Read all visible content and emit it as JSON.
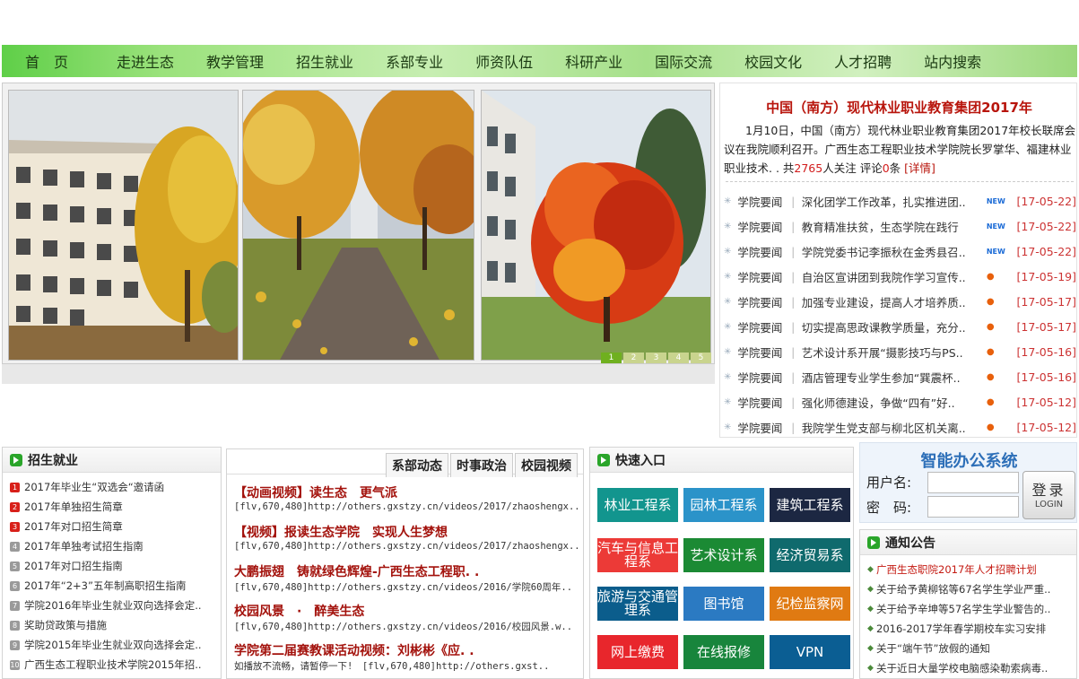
{
  "nav": {
    "items": [
      "首　页",
      "走进生态",
      "教学管理",
      "招生就业",
      "系部专业",
      "师资队伍",
      "科研产业",
      "国际交流",
      "校园文化",
      "人才招聘",
      "站内搜索"
    ]
  },
  "slider": {
    "pages": [
      "1",
      "2",
      "3",
      "4",
      "5"
    ],
    "active_page": "1"
  },
  "headline": {
    "title": "中国（南方）现代林业职业教育集团2017年",
    "body_text": "1月10日，中国（南方）现代林业职业教育集团2017年校长联席会议在我院顺利召开。广西生态工程职业技术学院院长罗掌华、福建林业职业技术. . 共",
    "views_count": "2765",
    "views_suffix": "人关注 评论",
    "comments_count": "0",
    "comments_suffix": "条",
    "more_label": "[详情]"
  },
  "news": [
    {
      "category": "学院要闻",
      "title": "深化团学工作改革，扎实推进团..",
      "badge": "NEW",
      "date": "[17-05-22]"
    },
    {
      "category": "学院要闻",
      "title": "教育精准扶贫，生态学院在践行",
      "badge": "NEW",
      "date": "[17-05-22]"
    },
    {
      "category": "学院要闻",
      "title": "学院党委书记李振秋在金秀县召..",
      "badge": "NEW",
      "date": "[17-05-22]"
    },
    {
      "category": "学院要闻",
      "title": "自治区宣讲团到我院作学习宣传..",
      "badge": "hot",
      "date": "[17-05-19]"
    },
    {
      "category": "学院要闻",
      "title": "加强专业建设，提高人才培养质..",
      "badge": "hot",
      "date": "[17-05-17]"
    },
    {
      "category": "学院要闻",
      "title": "切实提高思政课教学质量，充分..",
      "badge": "hot",
      "date": "[17-05-17]"
    },
    {
      "category": "学院要闻",
      "title": "艺术设计系开展“摄影技巧与PS..",
      "badge": "hot",
      "date": "[17-05-16]"
    },
    {
      "category": "学院要闻",
      "title": "酒店管理专业学生参加“巽震杯..",
      "badge": "hot",
      "date": "[17-05-16]"
    },
    {
      "category": "学院要闻",
      "title": "强化师德建设，争做“四有”好..",
      "badge": "hot",
      "date": "[17-05-12]"
    },
    {
      "category": "学院要闻",
      "title": "我院学生党支部与柳北区机关离..",
      "badge": "hot",
      "date": "[17-05-12]"
    }
  ],
  "recruit": {
    "title": "招生就业",
    "items": [
      {
        "rank": "1",
        "text": "2017年毕业生“双选会“邀请函"
      },
      {
        "rank": "2",
        "text": "2017年单独招生简章"
      },
      {
        "rank": "3",
        "text": "2017年对口招生简章"
      },
      {
        "rank": "4",
        "text": "2017年单独考试招生指南"
      },
      {
        "rank": "5",
        "text": "2017年对口招生指南"
      },
      {
        "rank": "6",
        "text": "2017年“2+3”五年制高职招生指南"
      },
      {
        "rank": "7",
        "text": "学院2016年毕业生就业双向选择会定.."
      },
      {
        "rank": "8",
        "text": "奖助贷政策与措施"
      },
      {
        "rank": "9",
        "text": "学院2015年毕业生就业双向选择会定.."
      },
      {
        "rank": "10",
        "text": "广西生态工程职业技术学院2015年招.."
      }
    ]
  },
  "videos": {
    "tabs": [
      "系部动态",
      "时事政治",
      "校园视频"
    ],
    "items": [
      {
        "title": "【动画视频】读生态　更气派",
        "url": "[flv,670,480]http://others.gxstzy.cn/videos/2017/zhaoshengx.."
      },
      {
        "title": "【视频】报读生态学院　实现人生梦想",
        "url": "[flv,670,480]http://others.gxstzy.cn/videos/2017/zhaoshengx.."
      },
      {
        "title": "大鹏振翅　铸就绿色辉煌-广西生态工程职. .",
        "url": "[flv,670,480]http://others.gxstzy.cn/videos/2016/学院60周年.."
      },
      {
        "title": "校园风景　·　醉美生态",
        "url": "[flv,670,480]http://others.gxstzy.cn/videos/2016/校园风景.w.."
      },
      {
        "title": "学院第二届赛教课活动视频：刘彬彬《应. .",
        "url": "如播放不流畅，请暂停一下!　[flv,670,480]http://others.gxst.."
      }
    ]
  },
  "quick": {
    "title": "快速入口",
    "buttons": [
      {
        "label": "林业工程系",
        "color": "#12958e"
      },
      {
        "label": "园林工程系",
        "color": "#2b93c9"
      },
      {
        "label": "建筑工程系",
        "color": "#1c2742"
      },
      {
        "label": "汽车与信息工程系",
        "color": "#ec3a37"
      },
      {
        "label": "艺术设计系",
        "color": "#1b8a34"
      },
      {
        "label": "经济贸易系",
        "color": "#0f6a6d"
      },
      {
        "label": "旅游与交通管理系",
        "color": "#0b5d8c"
      },
      {
        "label": "图书馆",
        "color": "#2b7ac2"
      },
      {
        "label": "纪检监察网",
        "color": "#e07a12"
      },
      {
        "label": "网上缴费",
        "color": "#e8262c"
      },
      {
        "label": "在线报修",
        "color": "#18853c"
      },
      {
        "label": "VPN",
        "color": "#0b5e93"
      }
    ]
  },
  "office": {
    "title": "智能办公系统",
    "username_label": "用户名:",
    "password_label": "密　码:",
    "login_zh": "登录",
    "login_en": "LOGIN"
  },
  "notices": {
    "title": "通知公告",
    "items": [
      {
        "text": "广西生态职院2017年人才招聘计划",
        "highlight": true
      },
      {
        "text": "关于给予黄柳铭等67名学生学业严重..",
        "highlight": false
      },
      {
        "text": "关于给予辛坤等57名学生学业警告的..",
        "highlight": false
      },
      {
        "text": "2016-2017学年春学期校车实习安排",
        "highlight": false
      },
      {
        "text": "关于“端午节”放假的通知",
        "highlight": false
      },
      {
        "text": "关于近日大量学校电脑感染勒索病毒..",
        "highlight": false
      }
    ]
  }
}
